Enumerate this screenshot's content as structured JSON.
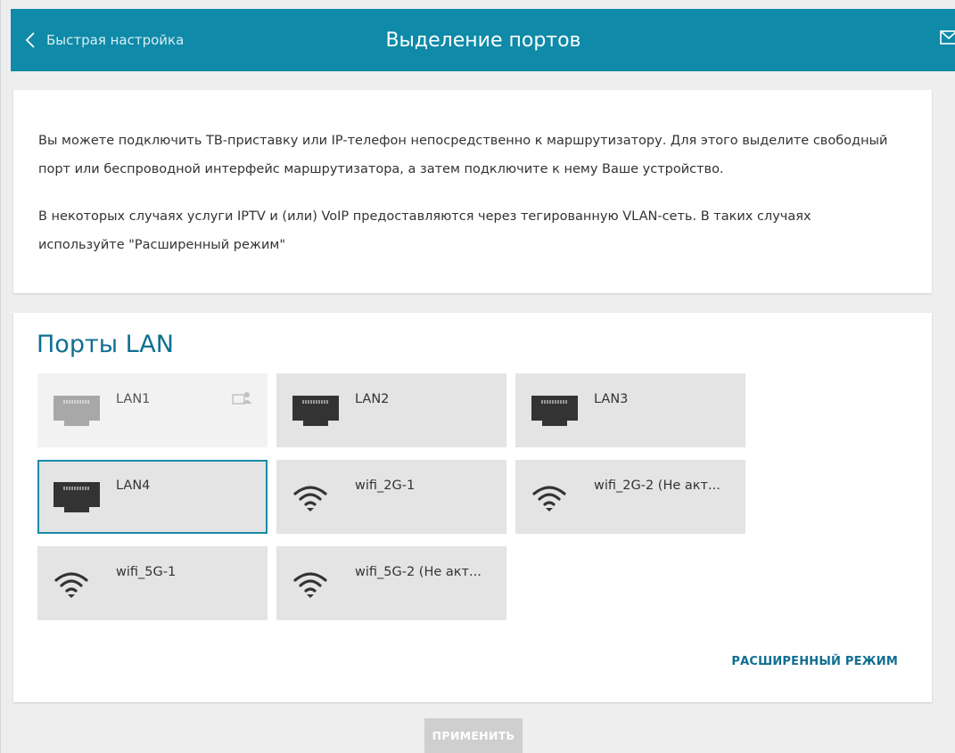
{
  "header": {
    "back_label": "Быстрая настройка",
    "title": "Выделение портов"
  },
  "info": {
    "paragraph1": "Вы можете подключить ТВ-приставку или IP-телефон непосредственно к маршрутизатору. Для этого выделите свободный порт или беспроводной интерфейс маршрутизатора, а затем подключите к нему Ваше устройство.",
    "paragraph2": "В некоторых случаях услуги IPTV и (или) VoIP предоставляются через тегированную VLAN-сеть. В таких случаях используйте \"Расширенный режим\""
  },
  "ports": {
    "title": "Порты LAN",
    "items": [
      {
        "label": "LAN1",
        "type": "lan",
        "state": "disabled"
      },
      {
        "label": "LAN2",
        "type": "lan",
        "state": "normal"
      },
      {
        "label": "LAN3",
        "type": "lan",
        "state": "normal"
      },
      {
        "label": "LAN4",
        "type": "lan",
        "state": "selected"
      },
      {
        "label": "wifi_2G-1",
        "type": "wifi",
        "state": "normal"
      },
      {
        "label": "wifi_2G-2 (Не акт...",
        "type": "wifi",
        "state": "normal"
      },
      {
        "label": "wifi_5G-1",
        "type": "wifi",
        "state": "normal"
      },
      {
        "label": "wifi_5G-2 (Не акт...",
        "type": "wifi",
        "state": "normal"
      }
    ],
    "advanced_link": "РАСШИРЕННЫЙ РЕЖИМ"
  },
  "apply_label": "ПРИМЕНИТЬ",
  "colors": {
    "header": "#0f8aa8",
    "accent": "#0f6f90",
    "tile": "#e4e4e4",
    "selected_border": "#1b8aa8",
    "icon_dark": "#333333",
    "icon_disabled": "#a8a8a8"
  }
}
